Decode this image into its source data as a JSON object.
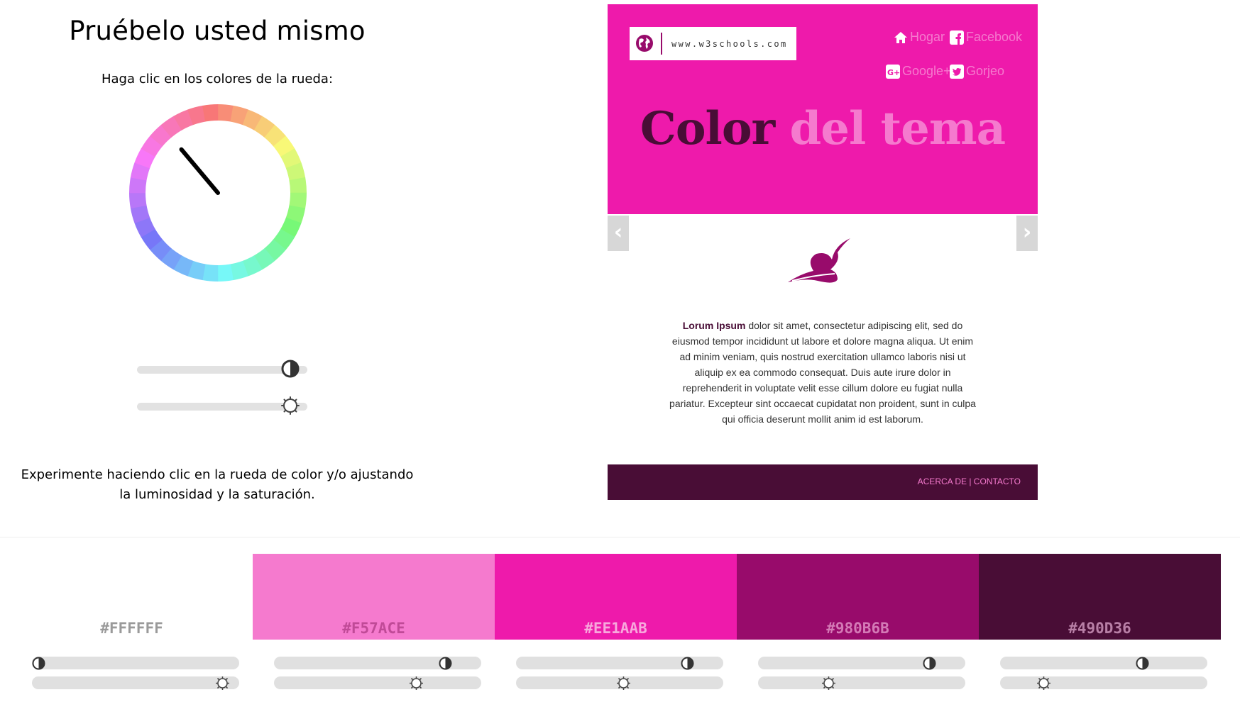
{
  "left": {
    "title": "Pruébelo usted mismo",
    "subtitle": "Haga clic en los colores de la rueda:",
    "instructions_line1": "Experimente haciendo clic en la rueda de color y/o ajustando",
    "instructions_line2": "la luminosidad y la saturación.",
    "saturation_level": 0.95,
    "lightness_level": 0.95,
    "wheel_pointer_angle_deg": -40
  },
  "preview": {
    "url": "www.w3schools.com",
    "nav": [
      "Hogar",
      "Facebook",
      "Google+",
      "Gorjeo"
    ],
    "hero_word1": "Color",
    "hero_word2": "del tema",
    "prev_arrow": "‹",
    "next_arrow": "›",
    "lorem_bold": "Lorum Ipsum",
    "lorem_lines": [
      "dolor sit amet, consectetur adipiscing elit, sed do",
      "eiusmod tempor incididunt ut labore et dolore magna aliqua. Ut enim",
      "ad minim veniam, quis nostrud exercitation ullamco laboris nisi ut",
      "aliquip ex ea commodo consequat. Duis aute irure dolor in",
      "reprehenderit in voluptate velit esse cillum dolore eu fugiat nulla",
      "pariatur. Excepteur sint occaecat cupidatat non proident, sunt in culpa",
      "qui officia deserunt mollit anim id est laborum."
    ],
    "footer_links": "ACERCA DE | CONTACTO"
  },
  "colors": {
    "accent_light": "#F57ACE",
    "accent": "#EE1AAB",
    "accent_dark": "#980B6B",
    "accent_darker": "#490D36"
  },
  "swatches": [
    {
      "hex": "#FFFFFF",
      "bg": "#FFFFFF",
      "text_color": "#9a9a9a",
      "contrast_level": 0.0,
      "brightness_level": 0.95
    },
    {
      "hex": "#F57ACE",
      "bg": "#F57ACE",
      "text_color": "#c04a97",
      "contrast_level": 0.85,
      "brightness_level": 0.7
    },
    {
      "hex": "#EE1AAB",
      "bg": "#EE1AAB",
      "text_color": "#f7a8dc",
      "contrast_level": 0.85,
      "brightness_level": 0.52
    },
    {
      "hex": "#980B6B",
      "bg": "#980B6B",
      "text_color": "#d47ab6",
      "contrast_level": 0.85,
      "brightness_level": 0.33
    },
    {
      "hex": "#490D36",
      "bg": "#490D36",
      "text_color": "#b87fa6",
      "contrast_level": 0.7,
      "brightness_level": 0.19
    }
  ]
}
